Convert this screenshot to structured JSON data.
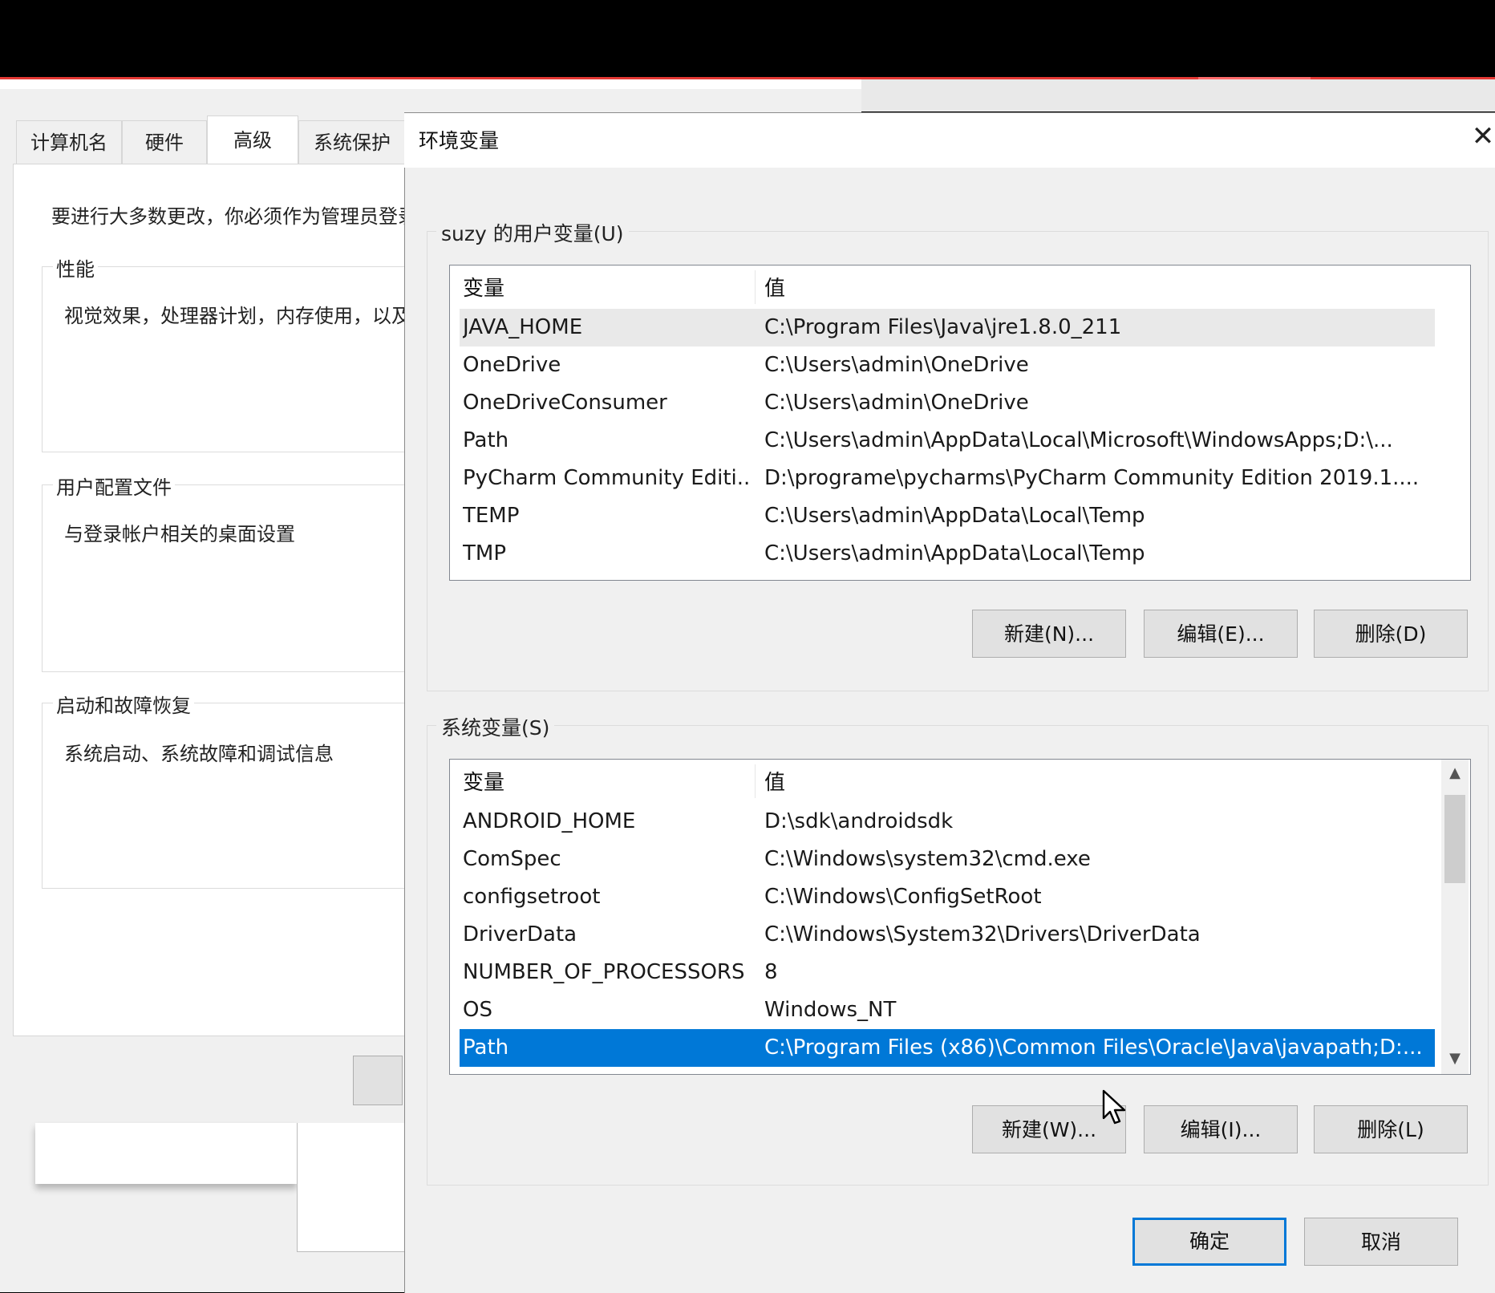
{
  "background_window": {
    "tabs": [
      "计算机名",
      "硬件",
      "高级",
      "系统保护"
    ],
    "active_tab": "高级",
    "notice": "要进行大多数更改，你必须作为管理员登录",
    "groups": [
      {
        "title": "性能",
        "description": "视觉效果，处理器计划，内存使用，以及虚拟内存"
      },
      {
        "title": "用户配置文件",
        "description": "与登录帐户相关的桌面设置"
      },
      {
        "title": "启动和故障恢复",
        "description": "系统启动、系统故障和调试信息"
      }
    ]
  },
  "dialog": {
    "title": "环境变量",
    "close_glyph": "✕",
    "user_vars": {
      "group_title": "suzy 的用户变量(U)",
      "header": {
        "name": "变量",
        "value": "值"
      },
      "rows": [
        {
          "name": "JAVA_HOME",
          "value": "C:\\Program Files\\Java\\jre1.8.0_211"
        },
        {
          "name": "OneDrive",
          "value": "C:\\Users\\admin\\OneDrive"
        },
        {
          "name": "OneDriveConsumer",
          "value": "C:\\Users\\admin\\OneDrive"
        },
        {
          "name": "Path",
          "value": "C:\\Users\\admin\\AppData\\Local\\Microsoft\\WindowsApps;D:\\..."
        },
        {
          "name": "PyCharm Community Editi...",
          "value": "D:\\programe\\pycharms\\PyCharm Community Edition 2019.1...."
        },
        {
          "name": "TEMP",
          "value": "C:\\Users\\admin\\AppData\\Local\\Temp"
        },
        {
          "name": "TMP",
          "value": "C:\\Users\\admin\\AppData\\Local\\Temp"
        }
      ],
      "buttons": {
        "new": "新建(N)...",
        "edit": "编辑(E)...",
        "delete": "删除(D)"
      }
    },
    "system_vars": {
      "group_title": "系统变量(S)",
      "header": {
        "name": "变量",
        "value": "值"
      },
      "rows": [
        {
          "name": "ANDROID_HOME",
          "value": "D:\\sdk\\androidsdk"
        },
        {
          "name": "ComSpec",
          "value": "C:\\Windows\\system32\\cmd.exe"
        },
        {
          "name": "configsetroot",
          "value": "C:\\Windows\\ConfigSetRoot"
        },
        {
          "name": "DriverData",
          "value": "C:\\Windows\\System32\\Drivers\\DriverData"
        },
        {
          "name": "NUMBER_OF_PROCESSORS",
          "value": "8"
        },
        {
          "name": "OS",
          "value": "Windows_NT"
        },
        {
          "name": "Path",
          "value": "C:\\Program Files (x86)\\Common Files\\Oracle\\Java\\javapath;D:..."
        }
      ],
      "selected_row": "Path",
      "buttons": {
        "new": "新建(W)...",
        "edit": "编辑(I)...",
        "delete": "删除(L)"
      }
    },
    "ok_label": "确定",
    "cancel_label": "取消"
  },
  "colors": {
    "selection": "#0078d7",
    "accent_red": "#e53935"
  }
}
